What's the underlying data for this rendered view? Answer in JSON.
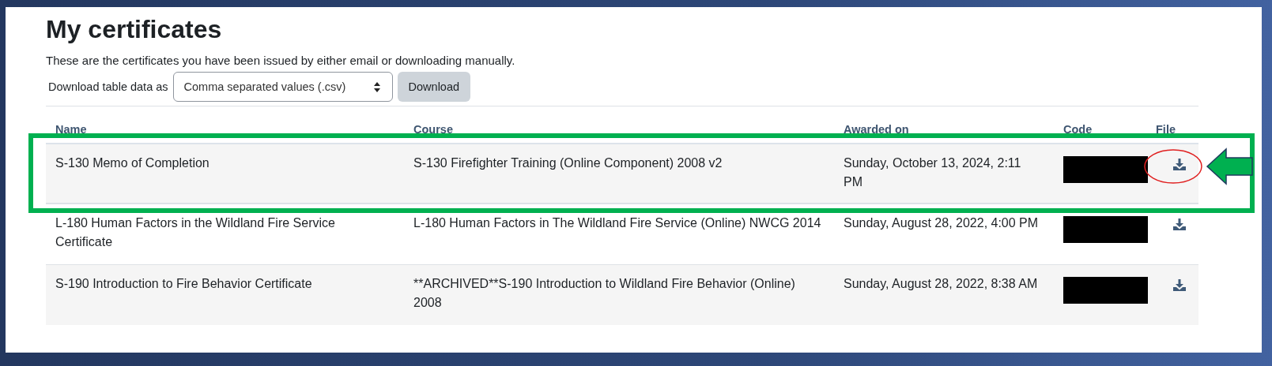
{
  "page": {
    "title": "My certificates",
    "description": "These are the certificates you have been issued by either email or downloading manually.",
    "download": {
      "label": "Download table data as",
      "format": "Comma separated values (.csv)",
      "button": "Download"
    }
  },
  "table": {
    "columns": [
      "Name",
      "Course",
      "Awarded on",
      "Code",
      "File"
    ],
    "rows": [
      {
        "name": "S-130 Memo of Completion",
        "course": "S-130 Firefighter Training (Online Component) 2008 v2",
        "awarded_on": "Sunday, October 13, 2024, 2:11 PM",
        "code_redacted": true,
        "highlighted": true
      },
      {
        "name": "L-180 Human Factors in the Wildland Fire Service Certificate",
        "course": "L-180 Human Factors in The Wildland Fire Service (Online) NWCG 2014",
        "awarded_on": "Sunday, August 28, 2022, 4:00 PM",
        "code_redacted": true,
        "highlighted": false
      },
      {
        "name": "S-190 Introduction to Fire Behavior Certificate",
        "course": "**ARCHIVED**S-190 Introduction to Wildland Fire Behavior (Online) 2008",
        "awarded_on": "Sunday, August 28, 2022, 8:38 AM",
        "code_redacted": true,
        "highlighted": false
      }
    ]
  }
}
